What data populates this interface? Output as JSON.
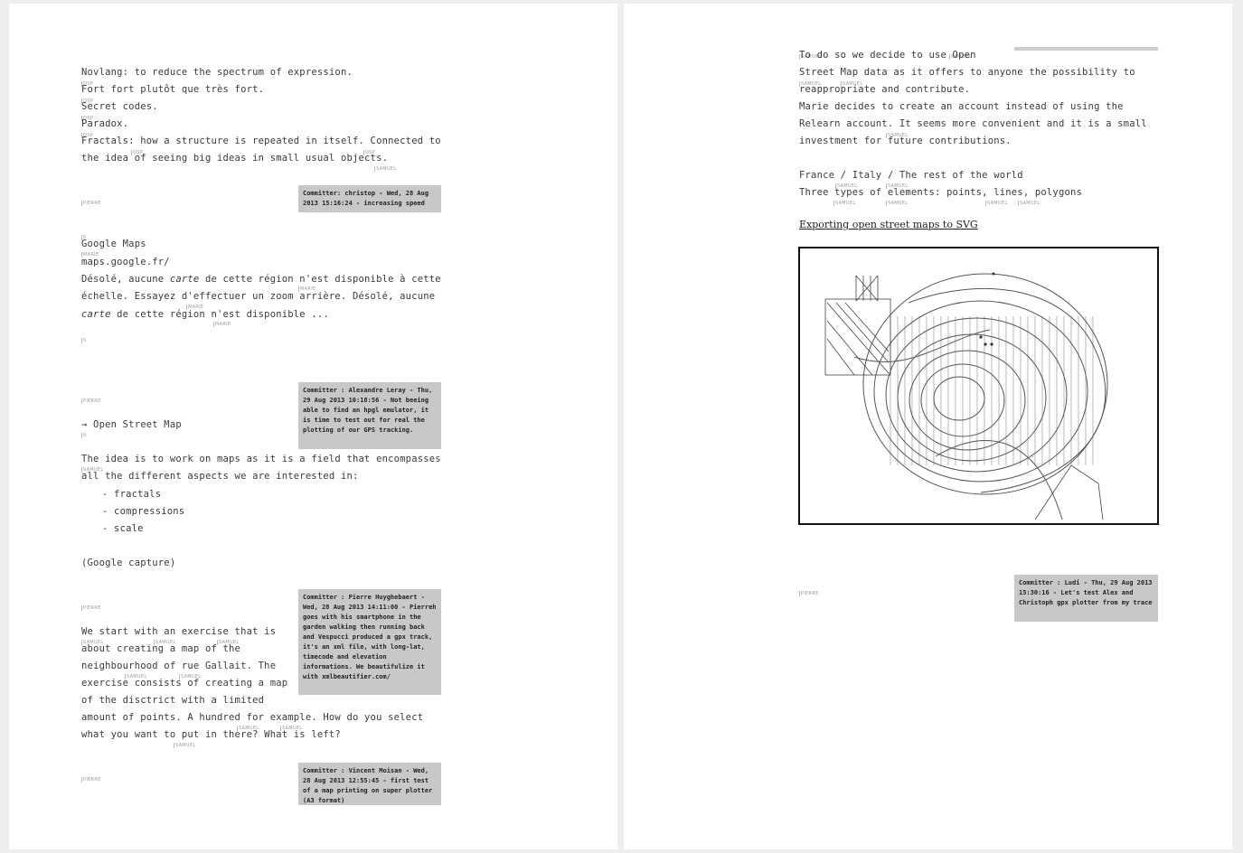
{
  "left": {
    "block1": [
      "Novlang: to reduce the spectrum of expression.",
      "Fort fort plutôt que très fort.",
      "Secret codes.",
      "Paradox.",
      "Fractals: how a structure is repeated in itself. Connected to",
      "the idea of seeing big ideas in small usual objects."
    ],
    "commit1": "Committer: christop - Wed, 28 Aug 2013 15:16:24 - increasing speed",
    "google_title": "Google Maps",
    "google_url": "maps.google.fr/",
    "desole_1a": "Désolé, aucune ",
    "desole_1b": "carte",
    "desole_1c": " de cette région n'est disponible à cette",
    "desole_2": "échelle. Essayez d'effectuer un zoom arrière. Désolé, aucune",
    "desole_3a": "carte",
    "desole_3b": " de cette région n'est disponible ...",
    "commit2": "Committer : Alexandre Leray - Thu, 29 Aug 2013 10:18:56 - Not beeing able to find an hpgl emulator, it is time to test out for real the plotting of our GPS tracking.",
    "osm_arrow": "→ Open Street Map",
    "idea_1": "The idea is to work on maps as it is a field that encompasses",
    "idea_2": "all the different aspects we are interested in:",
    "list": [
      "- fractals",
      "- compressions",
      "- scale"
    ],
    "google_capture": "(Google capture)",
    "commit3": "Committer : Pierre Huyghebaert - Wed, 28 Aug 2013 14:11:00 - Pierreh goes with his smartphone in the garden walking then running back and Vespucci produced a gpx track, it's an xml file, with long-lat, timecode and elevation informations. We beautifulize it with xmlbeautifier.com/",
    "exercise": [
      "We start with an exercise that is",
      "about creating a map of the",
      "neighbourhood of rue Gallait. The",
      "exercise consists of creating a map",
      "of the disctrict with a limited",
      "amount of points. A hundred for example. How do you select",
      "what you want to put in there? What is left?"
    ],
    "commit4": "Committer : Vincent Moisan - Wed, 28 Aug 2013 12:55:45 - first test of a map printing on super plotter (A3 format)"
  },
  "right": {
    "block1": [
      "To do so we decide to use Open",
      "Street Map data as it offers to anyone the possibility to",
      "reappropriate and contribute.",
      "Marie decides to create an account instead of using the",
      "Relearn account. It seems more convenient and it is a small",
      "investment for future contributions."
    ],
    "france": "France / Italy / The rest of the world",
    "three_types": "Three types of elements: points, lines, polygons",
    "export_link": "Exporting open street maps to SVG",
    "commit5": "Committer : Ludi - Thu, 29 Aug 2013 15:30:16 - Let's test Alex and Christoph gpx plotter from my trace"
  },
  "tags": {
    "pierre": "PIERRE",
    "samuel": "SAMUEL",
    "marie": "MARIE",
    "osp": "OSP",
    "s": "S"
  }
}
